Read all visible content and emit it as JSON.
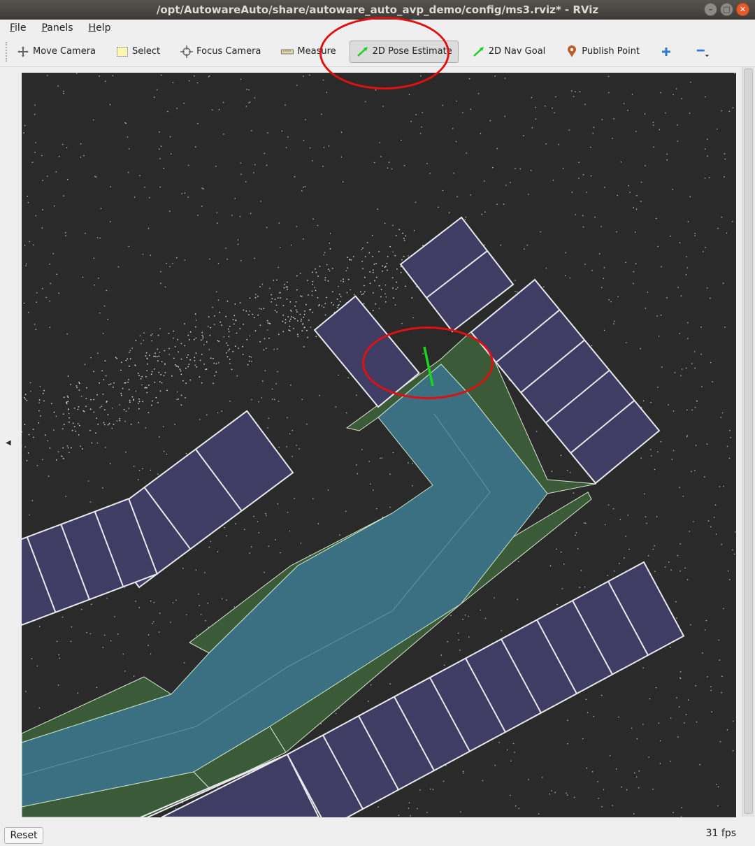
{
  "window": {
    "title": "/opt/AutowareAuto/share/autoware_auto_avp_demo/config/ms3.rviz* - RViz",
    "controls": [
      "minimize-icon",
      "maximize-icon",
      "close-icon"
    ]
  },
  "menubar": [
    "File",
    "Panels",
    "Help"
  ],
  "toolbar": {
    "tools": [
      {
        "label": "Move Camera",
        "icon": "move-camera-icon"
      },
      {
        "label": "Select",
        "icon": "select-icon"
      },
      {
        "label": "Focus Camera",
        "icon": "focus-camera-icon"
      },
      {
        "label": "Measure",
        "icon": "measure-icon"
      },
      {
        "label": "2D Pose Estimate",
        "icon": "pose-estimate-icon",
        "active": true
      },
      {
        "label": "2D Nav Goal",
        "icon": "nav-goal-icon"
      },
      {
        "label": "Publish Point",
        "icon": "publish-point-icon"
      }
    ],
    "add_icon": "plus-icon",
    "remove_icon": "minus-icon"
  },
  "viewport": {
    "background": "#2a2a2a",
    "drivable_color": "#3b6f82",
    "shoulder_color": "#3a5a38",
    "parking_color": "#3f3d63",
    "pose_arrow_color": "#19d619",
    "annotation_color": "#e01010"
  },
  "bottom": {
    "reset_label": "Reset",
    "fps": "31 fps"
  }
}
